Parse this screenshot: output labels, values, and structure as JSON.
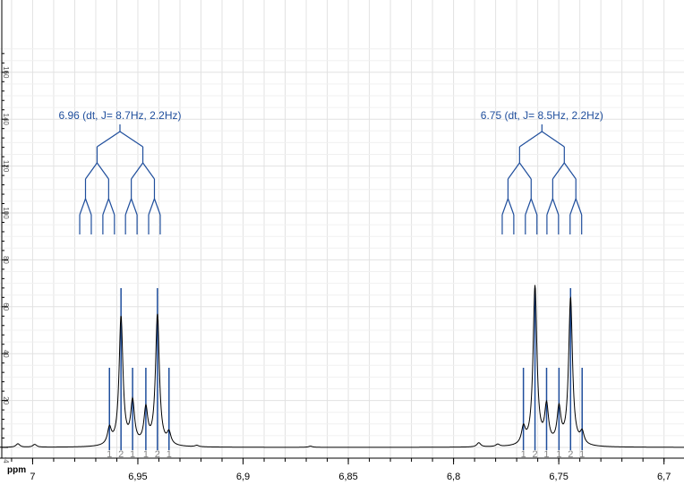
{
  "chart_data": {
    "type": "line",
    "xlabel": "ppm",
    "ylabel": "",
    "xlim": [
      7.0155,
      6.6905
    ],
    "ylim": [
      -3,
      174
    ],
    "x_reversed": true,
    "grid": true,
    "x_ticks": [
      7,
      6.95,
      6.9,
      6.85,
      6.8,
      6.75,
      6.7
    ],
    "x_tick_labels": [
      "7",
      "6,95",
      "6,9",
      "6,85",
      "6,8",
      "6,75",
      "6,7"
    ],
    "y_ticks": [
      0,
      20,
      40,
      60,
      80,
      100,
      120,
      140,
      160
    ],
    "y_tick_labels": [
      "-4",
      "20",
      "40",
      "60",
      "80",
      "100",
      "120",
      "140",
      "160"
    ],
    "baseline_bumps": [
      {
        "ppm": 7.007,
        "height": 1.5
      },
      {
        "ppm": 6.999,
        "height": 1.2
      },
      {
        "ppm": 6.788,
        "height": 1.8
      },
      {
        "ppm": 6.779,
        "height": 1.0
      },
      {
        "ppm": 6.922,
        "height": 0.6
      },
      {
        "ppm": 6.868,
        "height": 0.5
      }
    ],
    "multiplets": [
      {
        "label": "6.96 (dt, J= 8.7Hz, 2.2Hz)",
        "center": 6.9585,
        "J_large_hz": 8.7,
        "J_small_hz": 2.2,
        "lines": [
          {
            "ppm": 6.9635,
            "height": 7.0,
            "int": "1"
          },
          {
            "ppm": 6.958,
            "height": 55.0,
            "int": "2"
          },
          {
            "ppm": 6.9525,
            "height": 18.0,
            "int": "1"
          },
          {
            "ppm": 6.9462,
            "height": 15.0,
            "int": "1"
          },
          {
            "ppm": 6.9407,
            "height": 56.0,
            "int": "2"
          },
          {
            "ppm": 6.9352,
            "height": 5.0,
            "int": "1"
          }
        ]
      },
      {
        "label": "6.75 (dt, J= 8.5Hz, 2.2Hz)",
        "center": 6.758,
        "J_large_hz": 8.5,
        "J_small_hz": 2.2,
        "lines": [
          {
            "ppm": 6.7668,
            "height": 7.0,
            "int": "1"
          },
          {
            "ppm": 6.7613,
            "height": 68.0,
            "int": "2"
          },
          {
            "ppm": 6.7558,
            "height": 16.0,
            "int": "1"
          },
          {
            "ppm": 6.7499,
            "height": 15.0,
            "int": "1"
          },
          {
            "ppm": 6.7444,
            "height": 63.0,
            "int": "2"
          },
          {
            "ppm": 6.7389,
            "height": 5.0,
            "int": "1"
          }
        ]
      }
    ]
  },
  "colors": {
    "spectrum": "#000000",
    "annotation": "#1f4e9c",
    "grid": "#e2e2e2",
    "int_label": "#808080"
  }
}
